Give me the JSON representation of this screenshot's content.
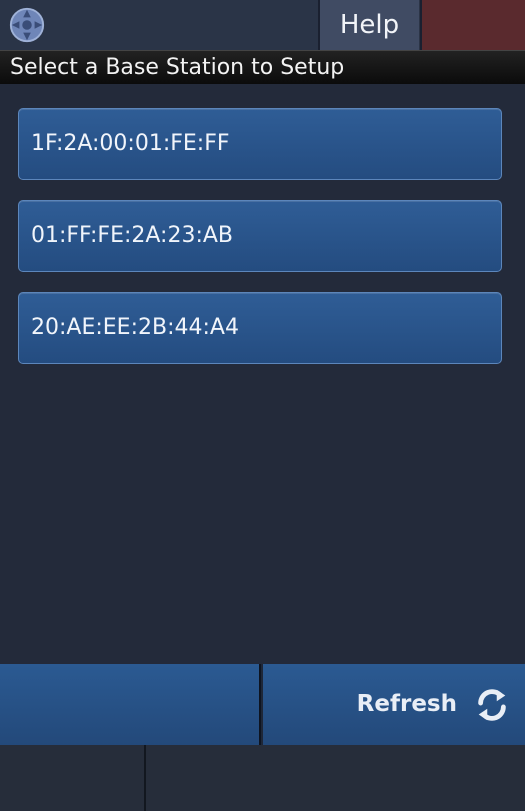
{
  "header": {
    "logo_icon": "app-logo-icon",
    "help_label": "Help",
    "title": "Select a Base Station to Setup"
  },
  "stations": [
    {
      "label": "1F:2A:00:01:FE:FF"
    },
    {
      "label": "01:FF:FE:2A:23:AB"
    },
    {
      "label": "20:AE:EE:2B:44:A4"
    }
  ],
  "toolbar": {
    "refresh_label": "Refresh",
    "refresh_icon": "refresh-icon"
  },
  "colors": {
    "accent": "#2b5a92",
    "background": "#232a3a",
    "alert": "#5a2a2e"
  }
}
